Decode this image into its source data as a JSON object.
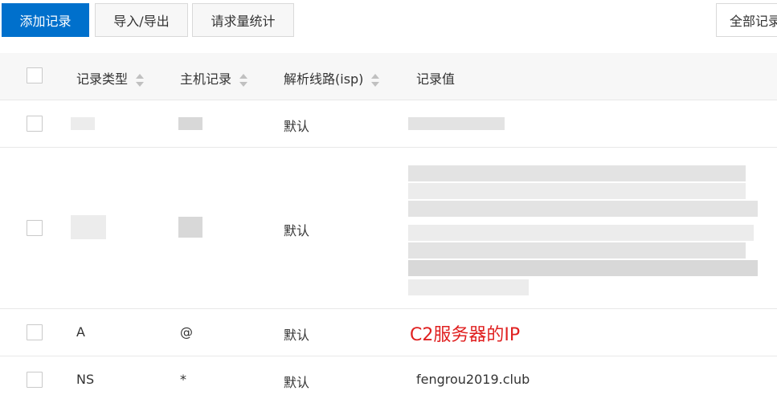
{
  "toolbar": {
    "add_label": "添加记录",
    "import_export_label": "导入/导出",
    "stats_label": "请求量统计",
    "filter_label": "全部记录"
  },
  "table": {
    "headers": {
      "type": "记录类型",
      "host": "主机记录",
      "line": "解析线路(isp)",
      "value": "记录值"
    },
    "rows": [
      {
        "type": "",
        "host": "",
        "line": "默认",
        "value": ""
      },
      {
        "type": "",
        "host": "",
        "line": "默认",
        "value": ""
      },
      {
        "type": "A",
        "host": "@",
        "line": "默认",
        "value": ""
      },
      {
        "type": "NS",
        "host": "*",
        "line": "默认",
        "value": "fengrou2019.club"
      }
    ]
  },
  "annotation": {
    "text": "C2服务器的IP",
    "color": "#e02020"
  },
  "colors": {
    "primary": "#0070cc",
    "header_bg": "#f7f7f7",
    "border": "#e8e8e8"
  }
}
